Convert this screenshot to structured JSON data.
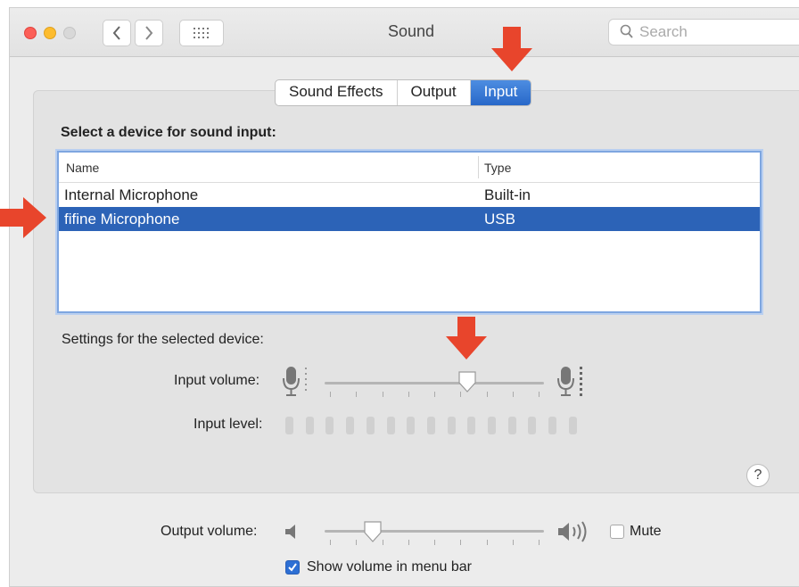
{
  "window": {
    "title": "Sound"
  },
  "toolbar": {
    "search_placeholder": "Search"
  },
  "tabs": [
    {
      "label": "Sound Effects",
      "active": false
    },
    {
      "label": "Output",
      "active": false
    },
    {
      "label": "Input",
      "active": true
    }
  ],
  "input": {
    "heading": "Select a device for sound input:",
    "columns": {
      "name": "Name",
      "type": "Type"
    },
    "devices": [
      {
        "name": "Internal Microphone",
        "type": "Built-in",
        "selected": false
      },
      {
        "name": "fifine Microphone",
        "type": "USB",
        "selected": true
      }
    ],
    "settings_label": "Settings for the selected device:",
    "volume_label": "Input volume:",
    "volume_fraction": 0.65,
    "level_label": "Input level:",
    "level_segments": 15
  },
  "output": {
    "volume_label": "Output volume:",
    "volume_fraction": 0.22,
    "mute_label": "Mute",
    "mute_checked": false,
    "show_in_menu_label": "Show volume in menu bar",
    "show_in_menu_checked": true
  },
  "help": {
    "label": "?"
  },
  "colors": {
    "accent": "#2c63b7",
    "selection": "#2c63b7",
    "arrow": "#e8452c"
  }
}
